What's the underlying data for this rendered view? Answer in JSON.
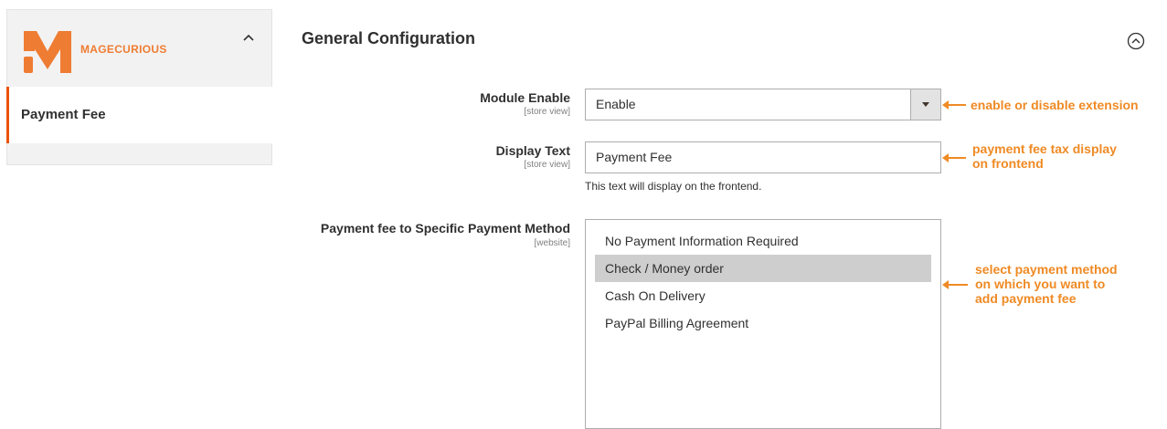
{
  "sidebar": {
    "brand": "MAGECURIOUS",
    "items": [
      {
        "label": "Payment Fee"
      }
    ]
  },
  "section": {
    "title": "General Configuration"
  },
  "fields": {
    "module_enable": {
      "label": "Module Enable",
      "scope": "[store view]",
      "value": "Enable"
    },
    "display_text": {
      "label": "Display Text",
      "scope": "[store view]",
      "value": "Payment Fee",
      "note": "This text will display on the frontend."
    },
    "payment_methods": {
      "label": "Payment fee to Specific Payment Method",
      "scope": "[website]",
      "options": [
        {
          "label": "No Payment Information Required",
          "selected": false
        },
        {
          "label": "Check / Money order",
          "selected": true
        },
        {
          "label": "Cash On Delivery",
          "selected": false
        },
        {
          "label": "PayPal Billing Agreement",
          "selected": false
        }
      ]
    }
  },
  "annotations": {
    "enable": "enable or disable extension",
    "display_line1": "payment fee tax display",
    "display_line2": "on frontend",
    "method_line1": "select payment method",
    "method_line2": "on which you want to",
    "method_line3": "add payment fee"
  },
  "colors": {
    "accent": "#eb5202",
    "annotation": "#ef8a24",
    "selected_option": "#cecece"
  }
}
